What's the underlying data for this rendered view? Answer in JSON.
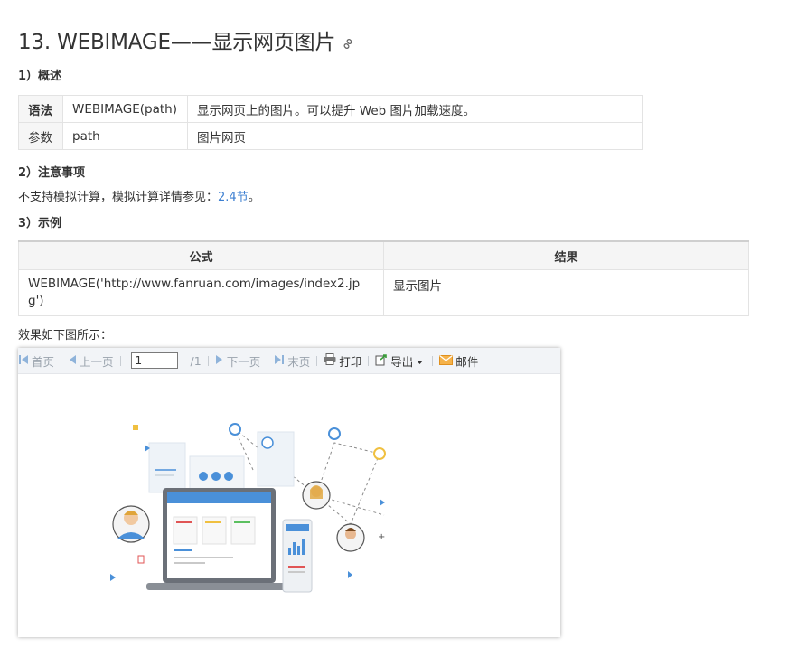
{
  "title": "13. WEBIMAGE——显示网页图片",
  "section1": "1）概述",
  "syntax_table": {
    "rows": [
      {
        "key": "语法",
        "param": "WEBIMAGE(path)",
        "desc": "显示网页上的图片。可以提升 Web 图片加载速度。"
      },
      {
        "key": "参数",
        "param": "path",
        "desc": "图片网页"
      }
    ]
  },
  "section2": "2）注意事项",
  "note": {
    "prefix": "不支持模拟计算，模拟计算详情参见：",
    "link": "2.4节",
    "suffix": "。"
  },
  "section3": "3）示例",
  "example_table": {
    "headers": [
      "公式",
      "结果"
    ],
    "formula": "WEBIMAGE('http://www.fanruan.com/images/index2.jpg')",
    "result": "显示图片"
  },
  "effect_caption": "效果如下图所示：",
  "toolbar": {
    "first": "首页",
    "prev": "上一页",
    "page_value": "1",
    "page_total": "/1",
    "next": "下一页",
    "last": "末页",
    "print": "打印",
    "export": "导出",
    "mail": "邮件"
  },
  "colors": {
    "link": "#3c7fd1",
    "accent_blue": "#4a90d9",
    "mail_orange": "#f0a030"
  }
}
